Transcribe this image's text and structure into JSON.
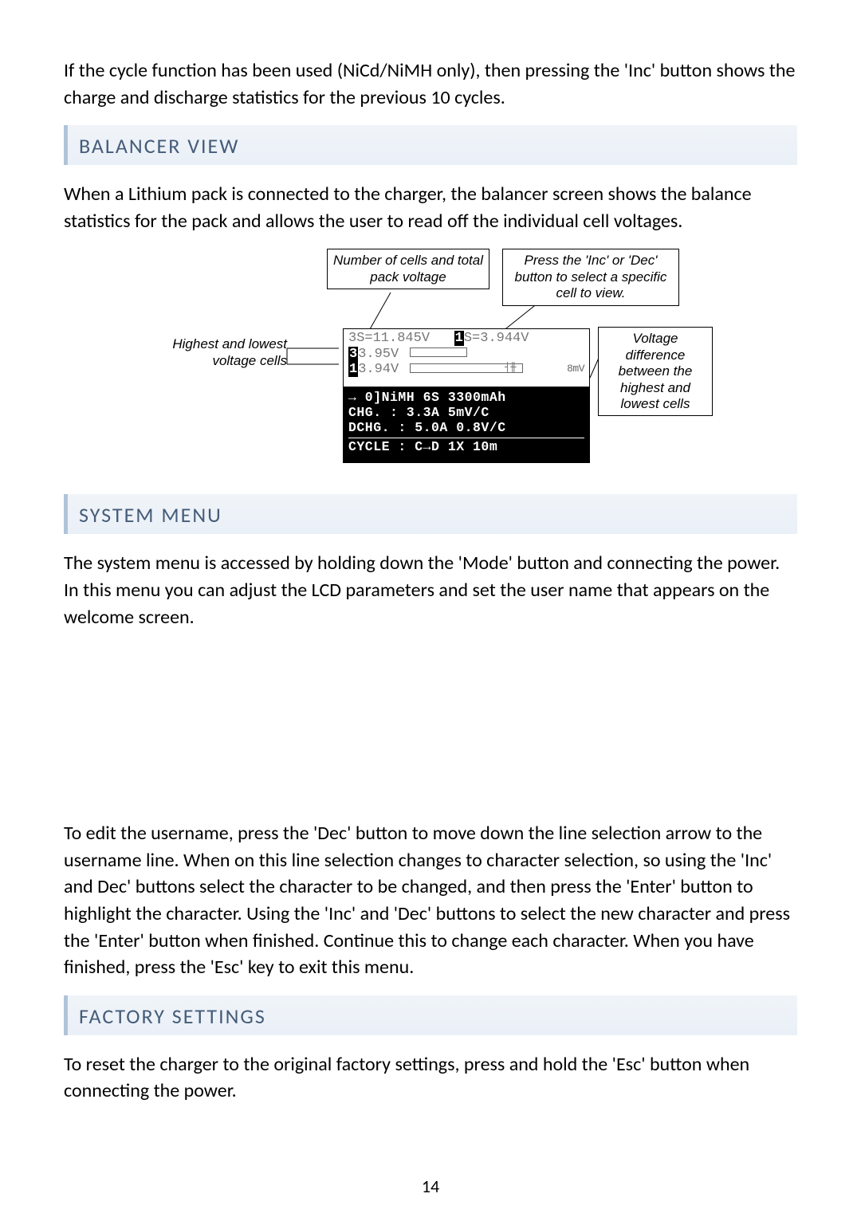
{
  "intro_paragraph": "If the cycle function has been used (NiCd/NiMH only), then pressing the 'Inc' button shows the charge and discharge statistics for the previous 10 cycles.",
  "sections": {
    "balancer": {
      "heading": "BALANCER VIEW",
      "paragraph": "When a Lithium pack is connected to the charger, the balancer screen shows the balance statistics for the pack and allows the user to read off the individual cell voltages.",
      "diagram": {
        "callouts": {
          "pack_voltage": "Number of cells and total pack voltage",
          "select_cell": "Press the 'Inc' or 'Dec' button to select a specific cell to view.",
          "hi_lo_cells": "Highest and lowest voltage cells",
          "voltage_diff": "Voltage difference between the highest and lowest cells"
        },
        "lcd_top": {
          "line1_left": "3S=11.845V",
          "line1_sel": "1",
          "line1_right": "S=3.944V",
          "line2_num": "3",
          "line2_val": "3.95V",
          "line3_num": "1",
          "line3_val": "3.94V",
          "delta": "8mV"
        },
        "lcd_bottom": {
          "line1": "→ 0]NiMH  6S  3300mAh",
          "line2": " CHG.  : 3.3A   5mV/C",
          "line3": " DCHG. : 5.0A  0.8V/C",
          "line4": " CYCLE :  C→D  1X 10m"
        }
      }
    },
    "system_menu": {
      "heading": "SYSTEM MENU",
      "paragraph1": "The system menu is accessed by holding down the 'Mode' button and connecting the power. In this menu you can adjust the LCD parameters and set the user name that appears on the welcome screen.",
      "paragraph2": "To edit the username, press the 'Dec' button to move down the line selection arrow to the username line. When on this line selection changes to character selection, so using the 'Inc' and Dec' buttons select the character to be changed, and then press the 'Enter' button to highlight the character. Using the 'Inc' and 'Dec' buttons to select the new character and press the 'Enter' button when finished. Continue this to change each character. When you have finished, press the 'Esc' key to exit this menu."
    },
    "factory": {
      "heading": "FACTORY SETTINGS",
      "paragraph": "To reset the charger to the original factory settings, press and hold the 'Esc' button when connecting the power."
    }
  },
  "page_number": "14"
}
